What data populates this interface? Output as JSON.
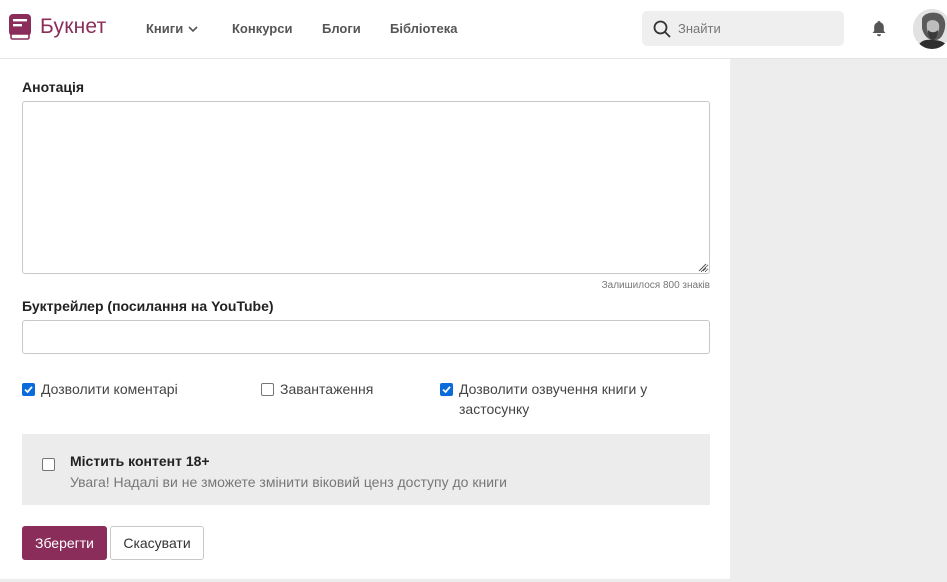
{
  "header": {
    "logo_text": "Букнет",
    "nav": {
      "books": "Книги",
      "contests": "Конкурси",
      "blogs": "Блоги",
      "library": "Бібліотека"
    },
    "search_placeholder": "Знайти",
    "icons": [
      "logo-book-icon",
      "chevron-down-icon",
      "search-icon",
      "bell-icon",
      "avatar"
    ]
  },
  "form": {
    "annotation_label": "Анотація",
    "annotation_value": "",
    "chars_remaining": "Залишилося 800 знаків",
    "trailer_label": "Буктрейлер (посилання на YouTube)",
    "trailer_value": "",
    "options": {
      "allow_comments": {
        "label": "Дозволити коментарі",
        "checked": true
      },
      "download": {
        "label": "Завантаження",
        "checked": false
      },
      "allow_voice": {
        "label": "Дозволити озвучення книги у застосунку",
        "checked": true
      }
    },
    "adult": {
      "title": "Містить контент 18+",
      "warning": "Увага! Надалі ви не зможете змінити віковий ценз доступу до книги",
      "checked": false
    },
    "save_label": "Зберегти",
    "cancel_label": "Скасувати"
  },
  "colors": {
    "brand": "#8a2d5a",
    "checkbox_checked": "#0a6cdc",
    "background": "#ededed"
  }
}
